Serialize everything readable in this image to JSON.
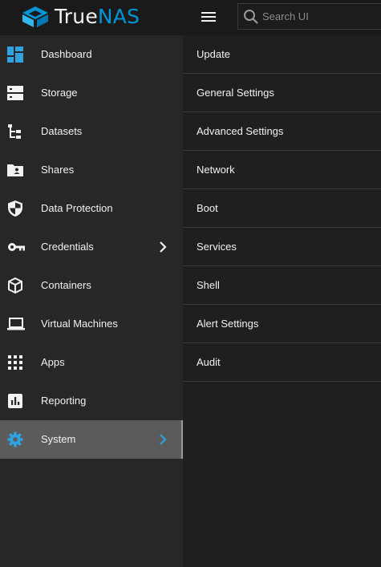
{
  "brand": {
    "name_prefix": "True",
    "name_suffix": "NAS",
    "accent_color": "#0095d5"
  },
  "header": {
    "search_placeholder": "Search UI"
  },
  "sidebar": {
    "items": [
      {
        "label": "Dashboard",
        "icon": "dashboard-icon"
      },
      {
        "label": "Storage",
        "icon": "storage-icon"
      },
      {
        "label": "Datasets",
        "icon": "datasets-icon"
      },
      {
        "label": "Shares",
        "icon": "shares-folder-icon"
      },
      {
        "label": "Data Protection",
        "icon": "shield-icon"
      },
      {
        "label": "Credentials",
        "icon": "key-icon",
        "has_submenu": true
      },
      {
        "label": "Containers",
        "icon": "container-box-icon"
      },
      {
        "label": "Virtual Machines",
        "icon": "laptop-icon"
      },
      {
        "label": "Apps",
        "icon": "apps-grid-icon"
      },
      {
        "label": "Reporting",
        "icon": "reporting-chart-icon"
      },
      {
        "label": "System",
        "icon": "gear-icon",
        "has_submenu": true,
        "active": true
      }
    ],
    "active_color": "#0095d5"
  },
  "submenu": {
    "items": [
      {
        "label": "Update"
      },
      {
        "label": "General Settings"
      },
      {
        "label": "Advanced Settings"
      },
      {
        "label": "Network"
      },
      {
        "label": "Boot"
      },
      {
        "label": "Services"
      },
      {
        "label": "Shell"
      },
      {
        "label": "Alert Settings"
      },
      {
        "label": "Audit"
      }
    ]
  }
}
